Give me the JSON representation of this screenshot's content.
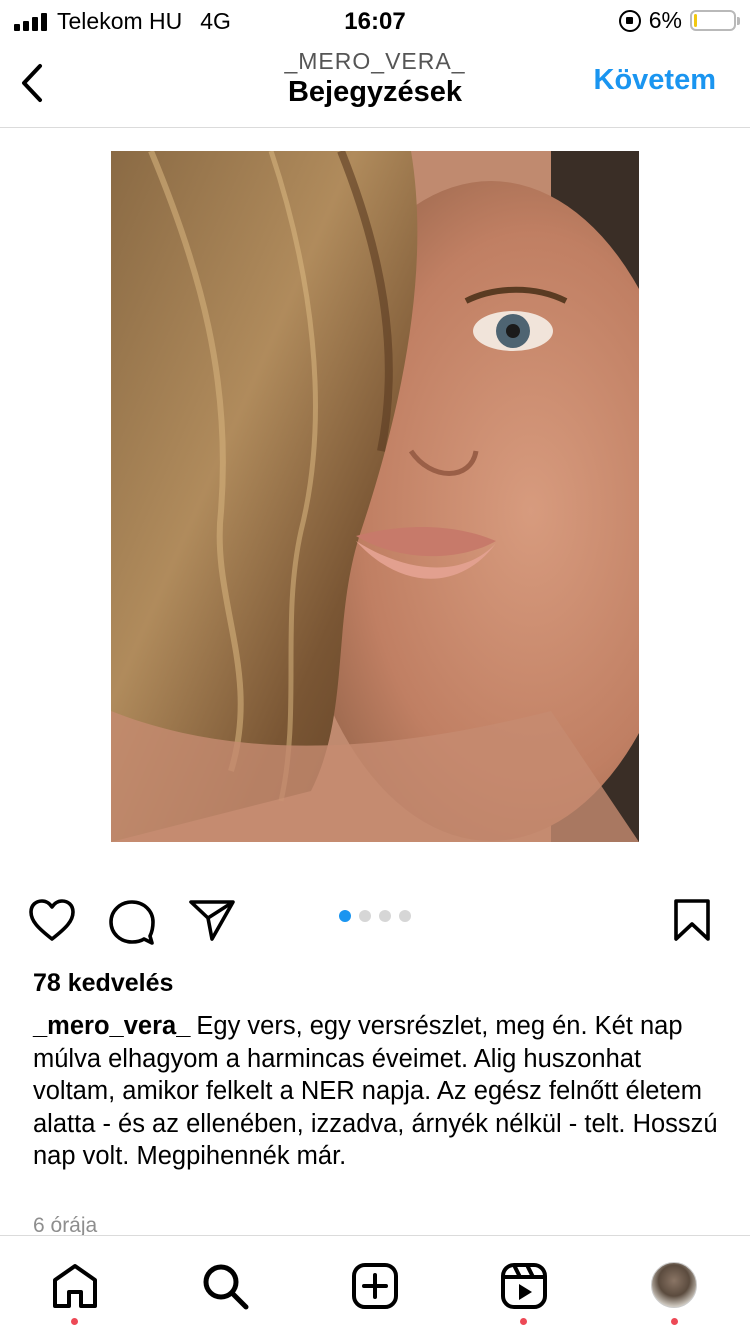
{
  "status_bar": {
    "carrier": "Telekom HU",
    "network": "4G",
    "time": "16:07",
    "battery": "6%",
    "battery_level": 0.06,
    "battery_color": "#f2c811"
  },
  "header": {
    "username": "_MERO_VERA_",
    "title": "Bejegyzések",
    "follow_label": "Követem",
    "accent_color": "#1a95f0"
  },
  "post": {
    "image_alt": "portrait photo",
    "carousel_pages": 4,
    "carousel_active": 1,
    "likes": "78 kedvelés",
    "caption_user": "_mero_vera_",
    "caption_text": "Egy vers, egy versrészlet, meg én. Két nap múlva elhagyom a harmincas éveimet. Alig huszonhat voltam, amikor felkelt a NER napja. Az egész felnőtt életem alatta - és az ellenében, izzadva, árnyék nélkül - telt. Hosszú nap volt. Megpihennék már.",
    "time_ago": "6 órája"
  },
  "actions": {
    "icons": [
      "heart-icon",
      "comment-icon",
      "share-icon",
      "bookmark-icon"
    ]
  },
  "bottom_nav": {
    "items": [
      "home-icon",
      "search-icon",
      "add-post-icon",
      "reels-icon",
      "profile-avatar"
    ],
    "notification_color": "#ed4956"
  }
}
